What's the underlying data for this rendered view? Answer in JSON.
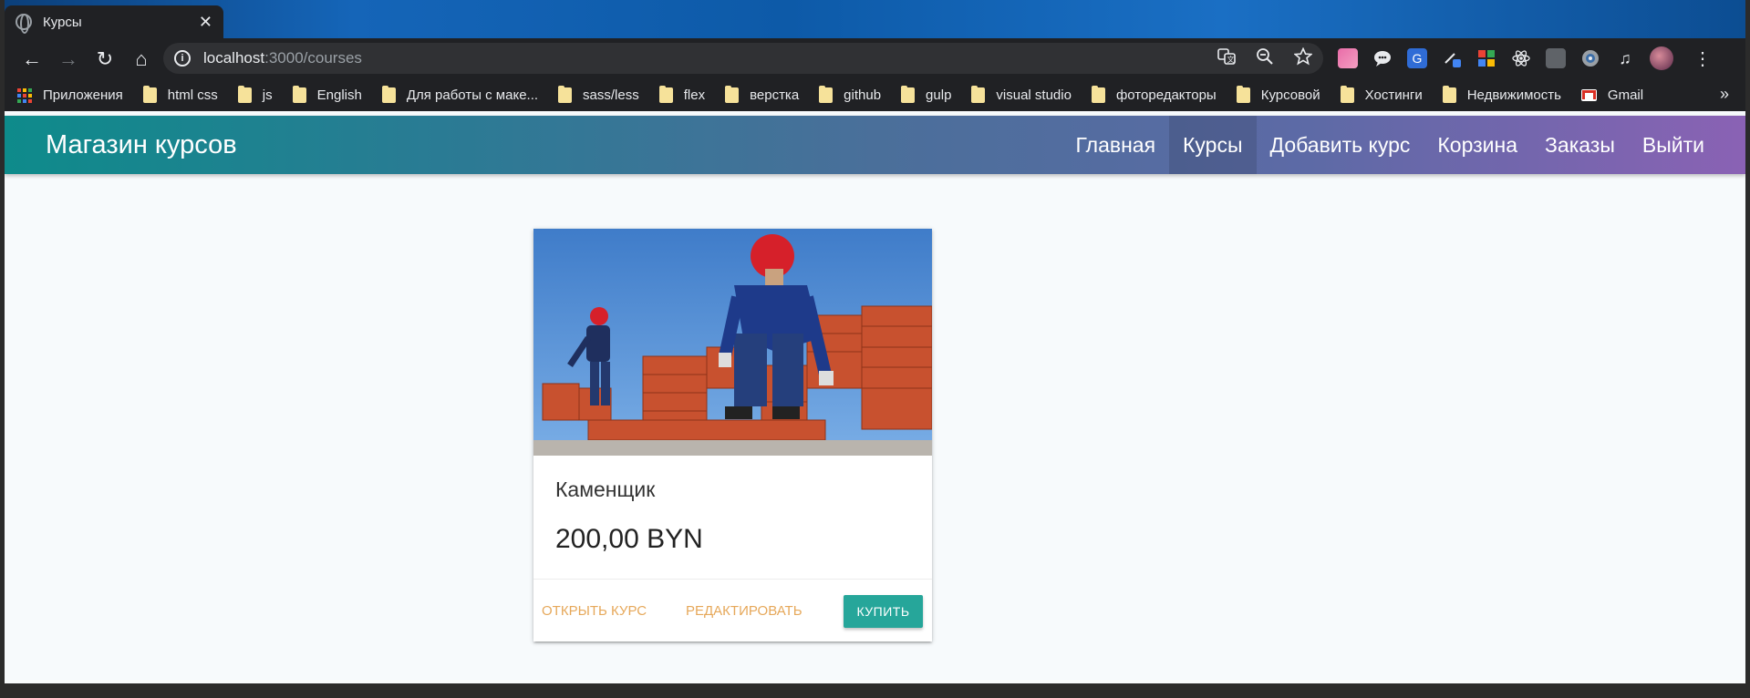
{
  "browser": {
    "tab": {
      "title": "Курсы",
      "close": "✕"
    },
    "nav": {
      "back": "←",
      "forward": "→",
      "reload": "↻",
      "home": "⌂"
    },
    "address": {
      "host": "localhost",
      "path": ":3000/courses",
      "info": "i"
    },
    "bookmarks": {
      "apps": "Приложения",
      "items": [
        "html css",
        "js",
        "English",
        "Для работы с маке...",
        "sass/less",
        "flex",
        "верстка",
        "github",
        "gulp",
        "visual studio",
        "фоторедакторы",
        "Курсовой",
        "Хостинги",
        "Недвижимость"
      ],
      "gmail": "Gmail",
      "more": "»"
    }
  },
  "site": {
    "brand": "Магазин курсов",
    "nav": [
      "Главная",
      "Курсы",
      "Добавить курс",
      "Корзина",
      "Заказы",
      "Выйти"
    ],
    "active_nav": "Курсы"
  },
  "card": {
    "title": "Каменщик",
    "price": "200,00 BYN",
    "actions": {
      "open": "Открыть курс",
      "edit": "Редактировать",
      "buy": "Купить"
    }
  },
  "colors": {
    "accent": "#26a69a",
    "link": "#e6a85a",
    "nav_gradient_start": "#0e8b8b",
    "nav_gradient_end": "#8a62b4"
  }
}
